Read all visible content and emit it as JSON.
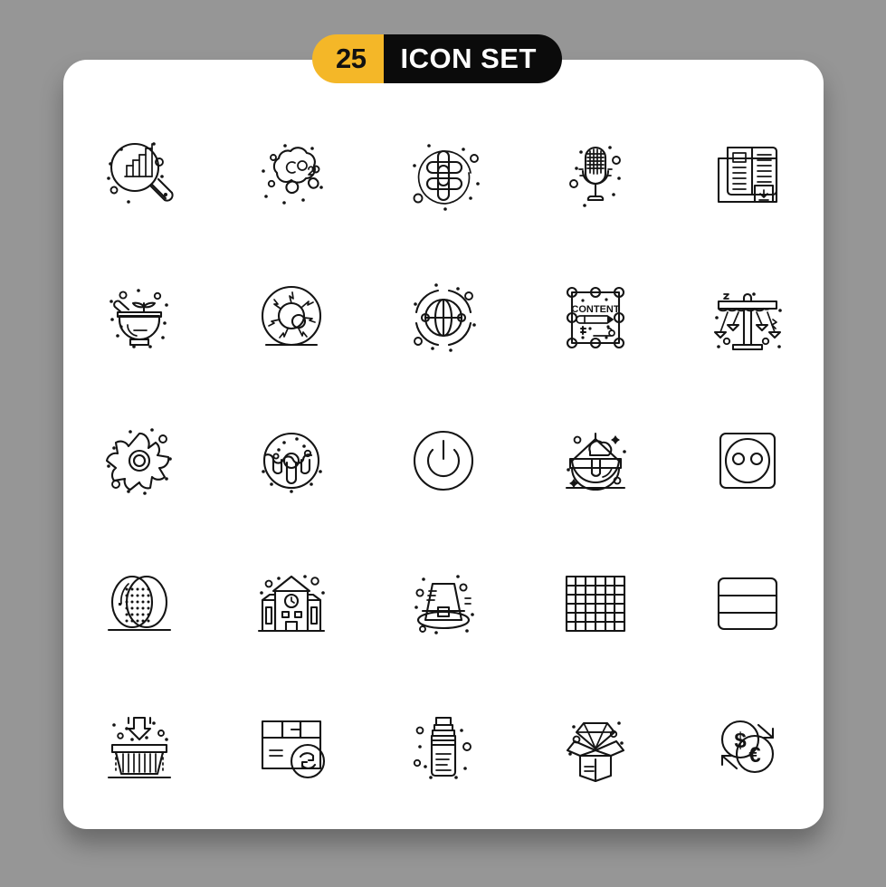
{
  "background_color": "#969696",
  "card_color": "#FFFFFF",
  "stroke_color": "#141414",
  "header": {
    "count": "25",
    "title": "ICON SET",
    "count_bg": "#F4B728",
    "title_bg": "#0B0B0B",
    "title_fg": "#FFFFFF",
    "count_fg": "#111111"
  },
  "grid": {
    "columns": 5,
    "rows": 5,
    "total_icons": 25
  },
  "icons": [
    {
      "index": 1,
      "name": "data-analysis-icon",
      "label": "Magnifier with bar chart"
    },
    {
      "index": 2,
      "name": "co2-cloud-icon",
      "label": "CO2 emission cloud"
    },
    {
      "index": 3,
      "name": "celtic-knot-icon",
      "label": "Celtic knot in circle"
    },
    {
      "index": 4,
      "name": "retro-microphone-icon",
      "label": "Vintage microphone"
    },
    {
      "index": 5,
      "name": "newspaper-download-icon",
      "label": "Newspaper with download badge"
    },
    {
      "index": 6,
      "name": "mortar-pestle-icon",
      "label": "Mortar and pestle with herb"
    },
    {
      "index": 7,
      "name": "eyeball-icon",
      "label": "Bloodshot eyeball"
    },
    {
      "index": 8,
      "name": "globe-selection-icon",
      "label": "Globe with selection handles"
    },
    {
      "index": 9,
      "name": "content-editing-icon",
      "label": "Content box with pencil",
      "text": "CONTENT"
    },
    {
      "index": 10,
      "name": "swing-carousel-icon",
      "label": "Swing carousel ride"
    },
    {
      "index": 11,
      "name": "flower-icon",
      "label": "Flower blossom"
    },
    {
      "index": 12,
      "name": "donut-icon",
      "label": "Glazed donut with sprinkles"
    },
    {
      "index": 13,
      "name": "power-button-icon",
      "label": "Power button"
    },
    {
      "index": 14,
      "name": "cleaning-bucket-icon",
      "label": "Bucket with foam and brush"
    },
    {
      "index": 15,
      "name": "power-socket-icon",
      "label": "Electrical socket"
    },
    {
      "index": 16,
      "name": "eggs-icon",
      "label": "Two eggs"
    },
    {
      "index": 17,
      "name": "school-building-icon",
      "label": "School building with clock"
    },
    {
      "index": 18,
      "name": "pilgrim-hat-icon",
      "label": "Pilgrim hat"
    },
    {
      "index": 19,
      "name": "grid-table-icon",
      "label": "Square grid table"
    },
    {
      "index": 20,
      "name": "rows-layout-icon",
      "label": "Horizontal rows layout"
    },
    {
      "index": 21,
      "name": "add-to-basket-icon",
      "label": "Shopping basket with down arrow"
    },
    {
      "index": 22,
      "name": "package-return-icon",
      "label": "Package with refresh arrows"
    },
    {
      "index": 23,
      "name": "water-bottle-icon",
      "label": "Water bottle"
    },
    {
      "index": 24,
      "name": "premium-box-icon",
      "label": "Open box with diamond"
    },
    {
      "index": 25,
      "name": "currency-exchange-icon",
      "label": "Dollar and euro exchange"
    }
  ]
}
